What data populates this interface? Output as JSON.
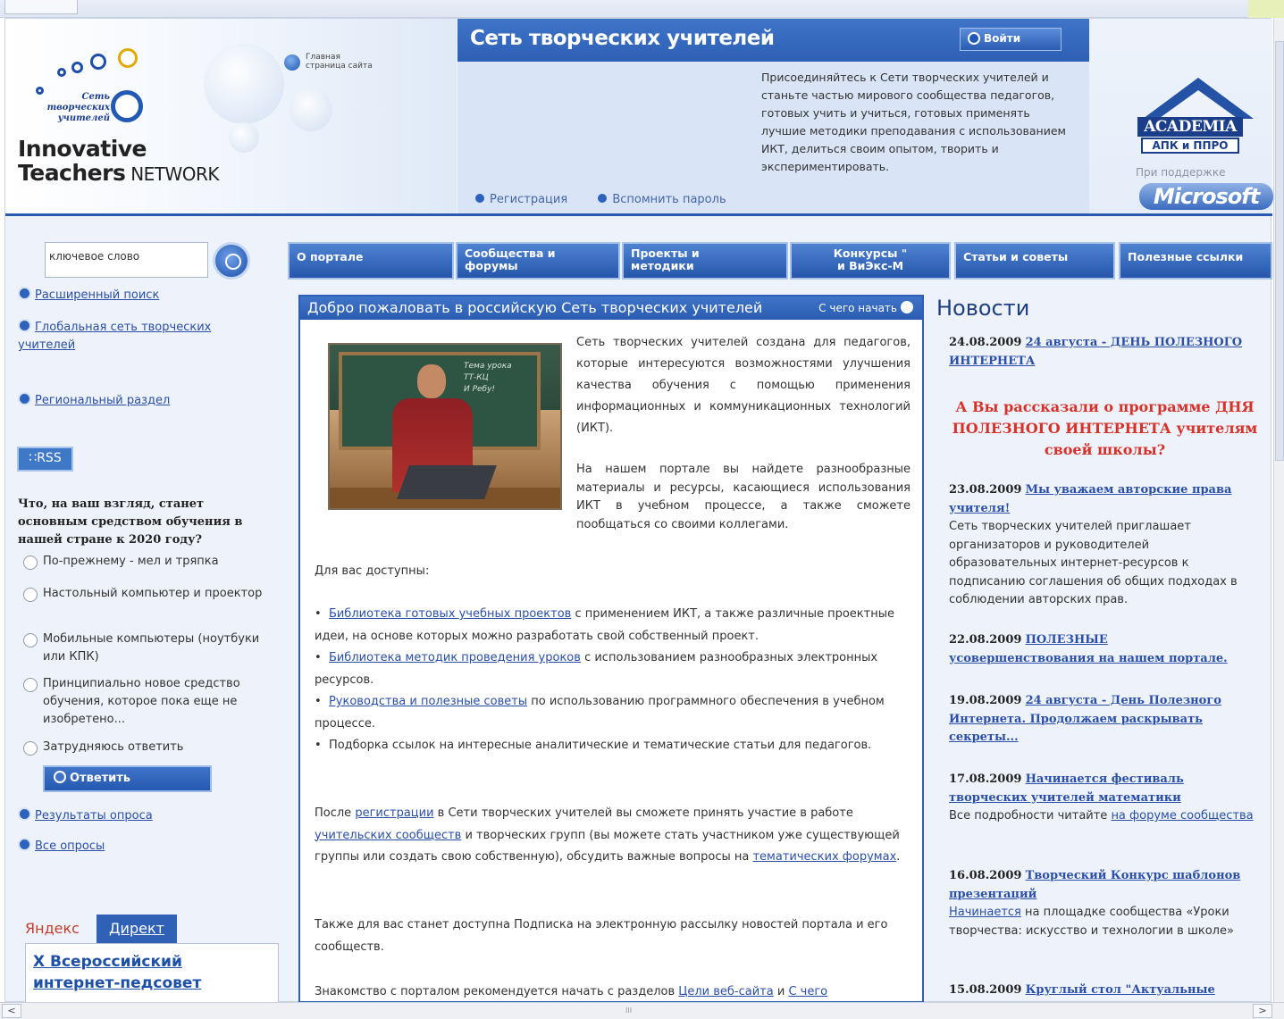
{
  "header": {
    "logo_small": [
      "Сеть",
      "творческих",
      "учителей"
    ],
    "brand_line1": "Innovative",
    "brand_line2_bold": "Teachers",
    "brand_line2_rest": " NETWORK",
    "home_link": "Главная страница сайта",
    "site_title": "Сеть творческих учителей",
    "login_label": "Войти",
    "intro": "Присоединяйтесь к Сети творческих учителей и станьте частью мирового сообщества педагогов, готовых учить и учиться, готовых применять лучшие методики преподавания с использованием ИКТ, делиться своим опытом, творить и экспериментировать.",
    "register_link": "Регистрация",
    "remind_link": "Вспомнить пароль",
    "academia": "ACADEMIA",
    "apk": "АПК и ППРО",
    "support_label": "При поддержке",
    "microsoft": "Microsoft"
  },
  "left": {
    "search_value": "ключевое слово",
    "links": [
      "Расширенный поиск",
      "Глобальная сеть творческих учителей",
      "Региональный раздел"
    ],
    "rss": "RSS",
    "poll_question": "Что, на ваш взгляд, станет основным средством обучения в нашей стране к 2020 году?",
    "poll_options": [
      "По-прежнему - мел и тряпка",
      "Настольный компьютер и проектор",
      "Мобильные компьютеры (ноутбуки или КПК)",
      "Принципиально новое средство обучения, которое пока еще не изобретено...",
      "Затрудняюсь ответить"
    ],
    "answer_button": "Ответить",
    "poll_links": [
      "Результаты опроса",
      "Все опросы"
    ],
    "yandex": "Яндекс",
    "direct": "Директ",
    "ad_line1": "X Всероссийский",
    "ad_line2": "интернет-педсовет"
  },
  "nav": [
    {
      "l1": "О портале",
      "l2": ""
    },
    {
      "l1": "Сообщества и",
      "l2": "форумы"
    },
    {
      "l1": "Проекты и",
      "l2": "методики"
    },
    {
      "l1": "Конкурсы \"",
      "l2": "и ВиЭкс-М"
    },
    {
      "l1": "Статьи и советы",
      "l2": ""
    },
    {
      "l1": "Полезные ссылки",
      "l2": ""
    }
  ],
  "welcome": {
    "title": "Добро пожаловать в российскую Сеть творческих учителей",
    "start_link": "С чего начать",
    "chalk": "Тема урока\nТТ-КЦ\nИ Ребу!",
    "p1": "Сеть творческих учителей создана для педагогов, которые интересуются возможностями улучшения качества обучения с помощью применения информационных и коммуникационных технологий (ИКТ).",
    "p2": "На нашем портале вы найдете разнообразные материалы и ресурсы, касающиеся использования ИКТ в учебном процессе, а также сможете пообщаться со своими коллегами.",
    "available": "Для вас доступны:",
    "b1_link": "Библиотека готовых учебных проектов",
    "b1_text": " с применением ИКТ, а также различные проектные идеи, на основе которых можно разработать свой собственный проект.",
    "b2_link": "Библиотека методик проведения уроков",
    "b2_text": " с использованием разнообразных электронных ресурсов.",
    "b3_link": "Руководства и полезные советы",
    "b3_text": " по использованию программного обеспечения в учебном процессе.",
    "b4_text": "Подборка ссылок на интересные аналитические и тематические статьи для педагогов.",
    "after_1": "После ",
    "after_link1": "регистрации",
    "after_2": " в Сети творческих учителей вы сможете принять участие в работе ",
    "after_link2": "учительских сообществ",
    "after_3": " и творческих групп (вы можете стать участником уже существующей группы или создать свою собственную), обсудить важные вопросы на ",
    "after_link3": "тематических форумах",
    "after_4": ".",
    "subscribe": "Также для вас станет доступна Подписка на электронную рассылку новостей портала и его сообществ.",
    "intro_1": "Знакомство с порталом рекомендуется начать с разделов ",
    "intro_link1": "Цели веб-сайта",
    "intro_2": " и ",
    "intro_link2": "С чего"
  },
  "news": {
    "title": "Новости",
    "promo": "А Вы рассказали о программе ДНЯ ПОЛЕЗНОГО ИНТЕРНЕТА учителям своей школы?",
    "items": [
      {
        "date": "24.08.2009",
        "link": "24 августа - ДЕНЬ ПОЛЕЗНОГО ИНТЕРНЕТА",
        "text": ""
      },
      {
        "date": "23.08.2009",
        "link": "Мы уважаем авторские права учителя!",
        "text": "Сеть творческих учителей приглашает организаторов и руководителей образовательных интернет-ресурсов к подписанию соглашения об общих подходах в соблюдении авторских прав."
      },
      {
        "date": "22.08.2009",
        "link": "ПОЛЕЗНЫЕ усовершенствования на нашем портале.",
        "text": ""
      },
      {
        "date": "19.08.2009",
        "link": "24 августа - День Полезного Интернета. Продолжаем раскрывать секреты...",
        "text": ""
      },
      {
        "date": "17.08.2009",
        "link": "Начинается фестиваль творческих учителей математики",
        "text_pre": "Все подробности читайте ",
        "text_link": "на форуме сообщества"
      },
      {
        "date": "16.08.2009",
        "link": "Творческий Конкурс шаблонов презентаций",
        "text_link_first": "Начинается",
        "text": " на площадке сообщества «Уроки творчества: искусство и технологии в школе»"
      },
      {
        "date": "15.08.2009",
        "link": "Круглый стол \"Актуальные",
        "text": ""
      }
    ]
  },
  "scrollbar": {
    "left": "<",
    "right": ">",
    "grip": "III"
  }
}
